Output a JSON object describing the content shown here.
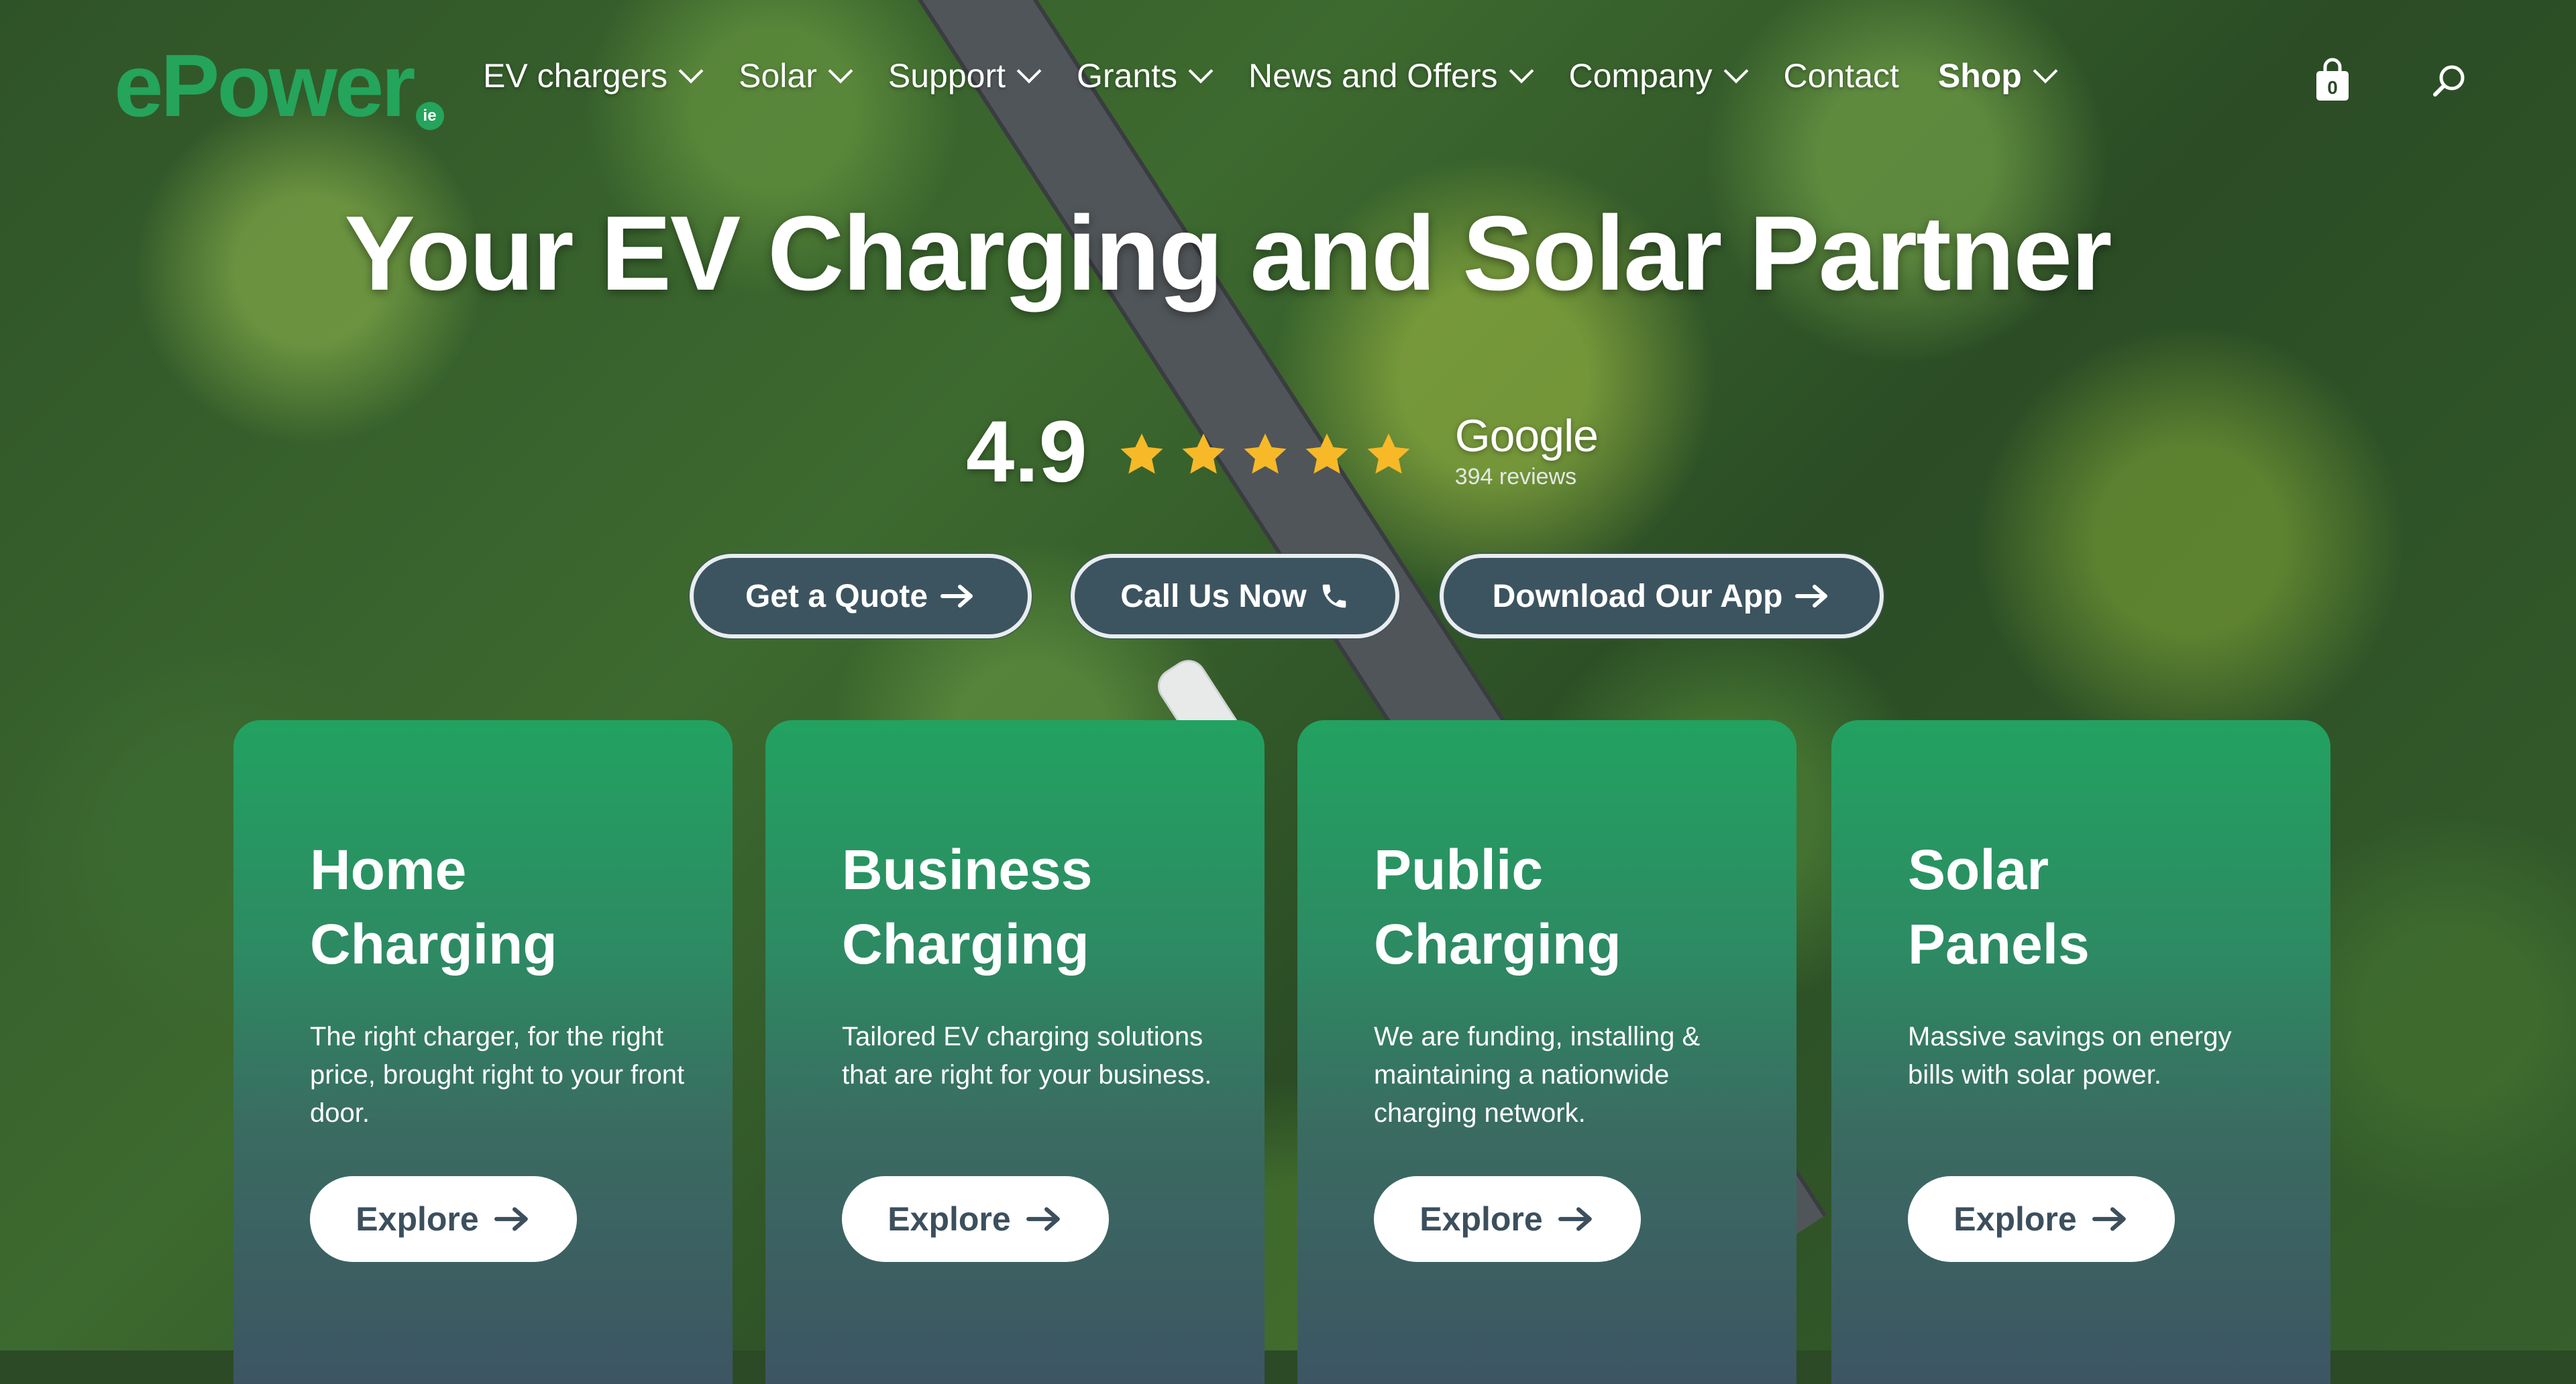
{
  "brand": {
    "name": "ePower",
    "suffix": "ie",
    "color": "#25a45c"
  },
  "nav": {
    "items": [
      {
        "label": "EV chargers",
        "dropdown": true
      },
      {
        "label": "Solar",
        "dropdown": true
      },
      {
        "label": "Support",
        "dropdown": true
      },
      {
        "label": "Grants",
        "dropdown": true
      },
      {
        "label": "News and Offers",
        "dropdown": true
      },
      {
        "label": "Company",
        "dropdown": true
      },
      {
        "label": "Contact",
        "dropdown": false
      },
      {
        "label": "Shop",
        "dropdown": true
      }
    ],
    "cart_count": "0",
    "icons": [
      "shopping-bag-icon",
      "search-icon"
    ]
  },
  "hero": {
    "title": "Your EV Charging and Solar Partner",
    "rating": "4.9",
    "stars": 5,
    "star_color": "#f7b928",
    "review_source": "Google",
    "review_count": "394 reviews",
    "buttons": [
      {
        "label": "Get a Quote",
        "icon": "arrow-right-icon"
      },
      {
        "label": "Call Us Now",
        "icon": "phone-icon"
      },
      {
        "label": "Download Our App",
        "icon": "arrow-right-icon"
      }
    ]
  },
  "cards": [
    {
      "title_line1": "Home",
      "title_line2": "Charging",
      "description": "The right charger, for the right price, brought right to your front door.",
      "button": "Explore"
    },
    {
      "title_line1": "Business",
      "title_line2": "Charging",
      "description": "Tailored EV charging solutions that are right for your business.",
      "button": "Explore"
    },
    {
      "title_line1": "Public",
      "title_line2": "Charging",
      "description": "We are funding, installing & maintaining a nationwide charging network.",
      "button": "Explore"
    },
    {
      "title_line1": "Solar",
      "title_line2": "Panels",
      "description": "Massive savings on energy bills with solar power.",
      "button": "Explore"
    }
  ],
  "colors": {
    "button_dark": "#3c5460",
    "card_top": "#22a261",
    "card_bottom": "#3d5563"
  }
}
